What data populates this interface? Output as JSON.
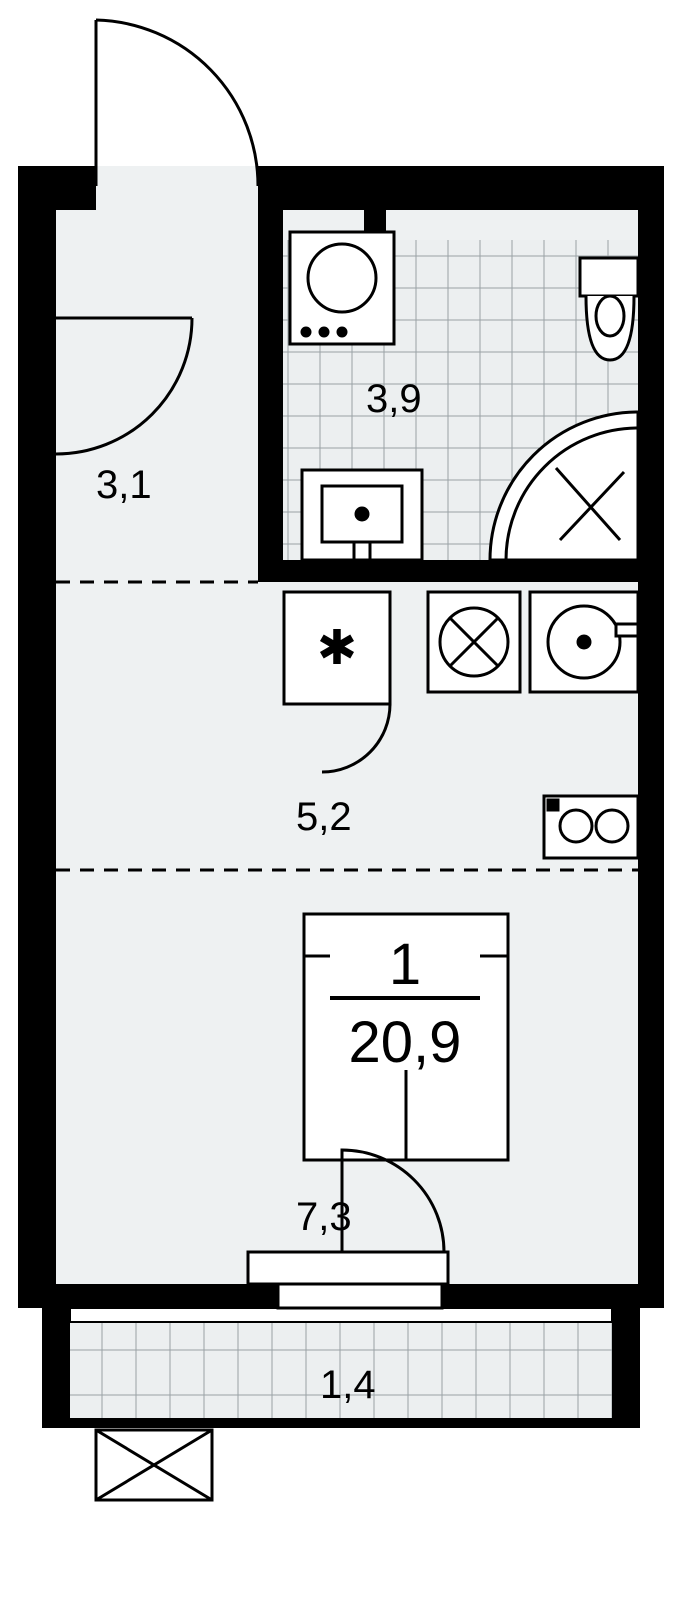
{
  "plan": {
    "unit_rooms_label": "1",
    "unit_total_area": "20,9",
    "rooms": {
      "hall": {
        "area": "3,1"
      },
      "bathroom": {
        "area": "3,9"
      },
      "kitchen": {
        "area": "5,2"
      },
      "living": {
        "area": "7,3"
      },
      "balcony": {
        "area": "1,4"
      }
    }
  }
}
